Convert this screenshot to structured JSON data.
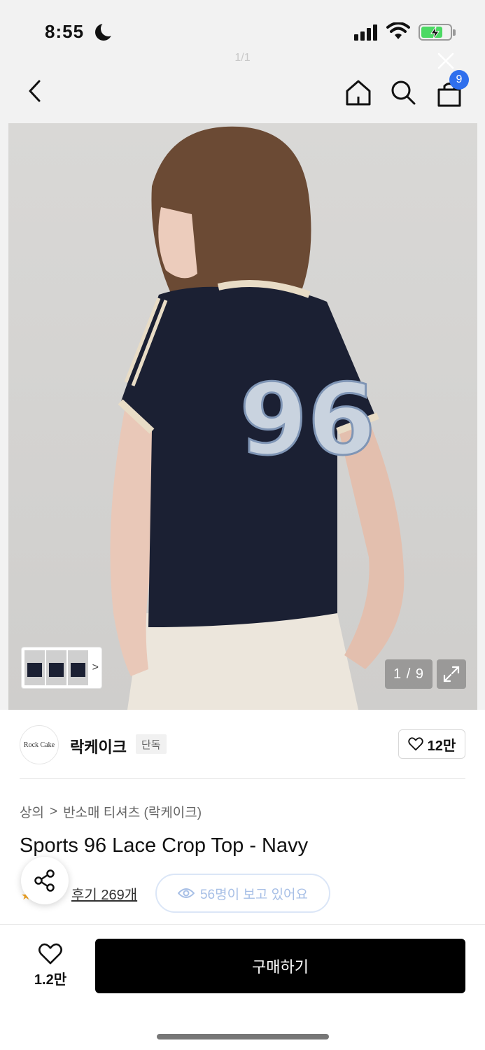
{
  "status_bar": {
    "time": "8:55"
  },
  "page_indicator": "1/1",
  "cart": {
    "badge_count": "9"
  },
  "gallery": {
    "counter": "1 / 9"
  },
  "brand": {
    "logo_text": "Rock Cake",
    "name": "락케이크",
    "tag": "단독",
    "likes": "12만"
  },
  "breadcrumb": {
    "category": "상의",
    "separator": ">",
    "subcategory": "반소매 티셔츠 (락케이크)"
  },
  "product": {
    "title": "Sports 96 Lace Crop Top - Navy",
    "reviews": "후기 269개",
    "viewers": "56명이 보고 있어요"
  },
  "bottom_bar": {
    "wish_count": "1.2만",
    "buy_label": "구매하기"
  },
  "colors": {
    "badge_blue": "#2f6fed",
    "buy_button": "#000000",
    "viewer_pill": "#a7bfe6",
    "battery_green": "#4cd964"
  },
  "icons": [
    "moon-icon",
    "cellular-signal-icon",
    "wifi-icon",
    "battery-charging-icon",
    "close-icon",
    "back-arrow-icon",
    "home-icon",
    "search-icon",
    "shopping-bag-icon",
    "chevron-right-icon",
    "expand-icon",
    "heart-icon",
    "share-icon",
    "eye-icon",
    "star-icon"
  ]
}
